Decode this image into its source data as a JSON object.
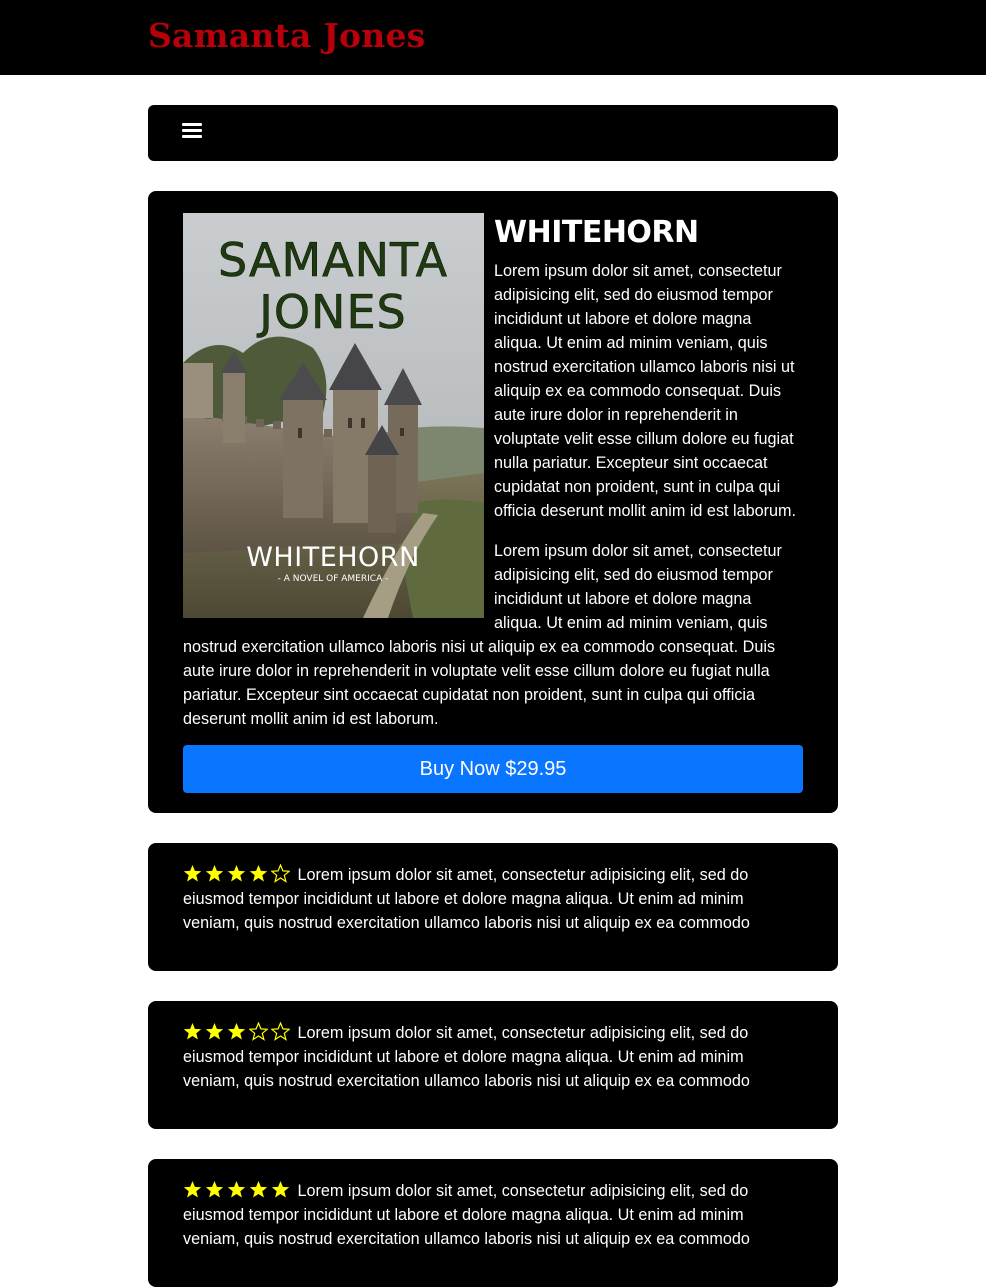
{
  "header": {
    "brand": "Samanta Jones"
  },
  "nav": {
    "menu_icon": "hamburger-menu-icon"
  },
  "book": {
    "title": "WHITEHORN",
    "cover": {
      "author": "SAMANTA JONES",
      "author_line1": "SAMANTA",
      "author_line2": "JONES",
      "title": "WHITEHORN",
      "subtitle": "- A NOVEL OF AMERICA -"
    },
    "paragraphs": [
      "Lorem ipsum dolor sit amet, consectetur adipisicing elit, sed do eiusmod tempor incididunt ut labore et dolore magna aliqua. Ut enim ad minim veniam, quis nostrud exercitation ullamco laboris nisi ut aliquip ex ea commodo consequat. Duis aute irure dolor in reprehenderit in voluptate velit esse cillum dolore eu fugiat nulla pariatur. Excepteur sint occaecat cupidatat non proident, sunt in culpa qui officia deserunt mollit anim id est laborum.",
      "Lorem ipsum dolor sit amet, consectetur adipisicing elit, sed do eiusmod tempor incididunt ut labore et dolore magna aliqua. Ut enim ad minim veniam, quis nostrud exercitation ullamco laboris nisi ut aliquip ex ea commodo consequat. Duis aute irure dolor in reprehenderit in voluptate velit esse cillum dolore eu fugiat nulla pariatur. Excepteur sint occaecat cupidatat non proident, sunt in culpa qui officia deserunt mollit anim id est laborum."
    ],
    "buy_label": "Buy Now $29.95"
  },
  "reviews": [
    {
      "rating": 4,
      "max": 5,
      "text": "Lorem ipsum dolor sit amet, consectetur adipisicing elit, sed do eiusmod tempor incididunt ut labore et dolore magna aliqua. Ut enim ad minim veniam, quis nostrud exercitation ullamco laboris nisi ut aliquip ex ea commodo"
    },
    {
      "rating": 3,
      "max": 5,
      "text": "Lorem ipsum dolor sit amet, consectetur adipisicing elit, sed do eiusmod tempor incididunt ut labore et dolore magna aliqua. Ut enim ad minim veniam, quis nostrud exercitation ullamco laboris nisi ut aliquip ex ea commodo"
    },
    {
      "rating": 5,
      "max": 5,
      "text": "Lorem ipsum dolor sit amet, consectetur adipisicing elit, sed do eiusmod tempor incididunt ut labore et dolore magna aliqua. Ut enim ad minim veniam, quis nostrud exercitation ullamco laboris nisi ut aliquip ex ea commodo"
    }
  ],
  "colors": {
    "brand": "#b8000b",
    "button": "#0a75ff",
    "star": "#ffff00",
    "card_bg": "#000000"
  }
}
